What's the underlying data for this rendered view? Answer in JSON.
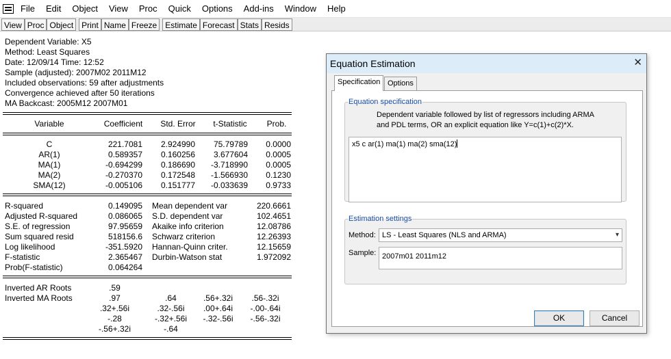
{
  "menubar": {
    "items": [
      "File",
      "Edit",
      "Object",
      "View",
      "Proc",
      "Quick",
      "Options",
      "Add-ins",
      "Window",
      "Help"
    ]
  },
  "toolbar": {
    "buttons": [
      "View",
      "Proc",
      "Object",
      "Print",
      "Name",
      "Freeze",
      "Estimate",
      "Forecast",
      "Stats",
      "Resids"
    ]
  },
  "output": {
    "header": [
      "Dependent Variable: X5",
      "Method: Least Squares",
      "Date: 12/09/14   Time: 12:52",
      "Sample (adjusted): 2007M02 2011M12",
      "Included observations: 59 after adjustments",
      "Convergence achieved after 50 iterations",
      "MA Backcast: 2005M12 2007M01"
    ],
    "coef_headers": [
      "Variable",
      "Coefficient",
      "Std. Error",
      "t-Statistic",
      "Prob."
    ],
    "coef_rows": [
      [
        "C",
        "221.7081",
        "2.924990",
        "75.79789",
        "0.0000"
      ],
      [
        "AR(1)",
        "0.589357",
        "0.160256",
        "3.677604",
        "0.0005"
      ],
      [
        "MA(1)",
        "-0.694299",
        "0.186690",
        "-3.718990",
        "0.0005"
      ],
      [
        "MA(2)",
        "-0.270370",
        "0.172548",
        "-1.566930",
        "0.1230"
      ],
      [
        "SMA(12)",
        "-0.005106",
        "0.151777",
        "-0.033639",
        "0.9733"
      ]
    ],
    "stats_rows": [
      [
        "R-squared",
        "0.149095",
        "Mean dependent var",
        "220.6661"
      ],
      [
        "Adjusted R-squared",
        "0.086065",
        "S.D. dependent var",
        "102.4651"
      ],
      [
        "S.E. of regression",
        "97.95659",
        "Akaike info criterion",
        "12.08786"
      ],
      [
        "Sum squared resid",
        "518156.6",
        "Schwarz criterion",
        "12.26393"
      ],
      [
        "Log likelihood",
        "-351.5920",
        "Hannan-Quinn criter.",
        "12.15659"
      ],
      [
        "F-statistic",
        "2.365467",
        "Durbin-Watson stat",
        "1.972092"
      ],
      [
        "Prob(F-statistic)",
        "0.064264",
        "",
        ""
      ]
    ],
    "roots_rows": [
      [
        "Inverted AR Roots",
        ".59",
        "",
        "",
        ""
      ],
      [
        "Inverted MA Roots",
        ".97",
        ".64",
        ".56+.32i",
        ".56-.32i"
      ],
      [
        "",
        ".32+.56i",
        ".32-.56i",
        ".00+.64i",
        "-.00-.64i"
      ],
      [
        "",
        "-.28",
        "-.32+.56i",
        "-.32-.56i",
        "-.56-.32i"
      ],
      [
        "",
        "-.56+.32i",
        "-.64",
        "",
        ""
      ]
    ]
  },
  "dialog": {
    "title": "Equation Estimation",
    "close_symbol": "✕",
    "tabs": [
      "Specification",
      "Options"
    ],
    "spec_group_label": "Equation specification",
    "spec_hint_line1": "Dependent variable followed by list of regressors including ARMA",
    "spec_hint_line2": "and PDL terms, OR an explicit equation like Y=c(1)+c(2)*X.",
    "spec_value": "x5 c ar(1) ma(1) ma(2) sma(12)",
    "est_group_label": "Estimation settings",
    "method_label": "Method:",
    "method_value": "LS  -  Least Squares (NLS and ARMA)",
    "sample_label": "Sample:",
    "sample_value": "2007m01 2011m12",
    "ok_label": "OK",
    "cancel_label": "Cancel"
  }
}
